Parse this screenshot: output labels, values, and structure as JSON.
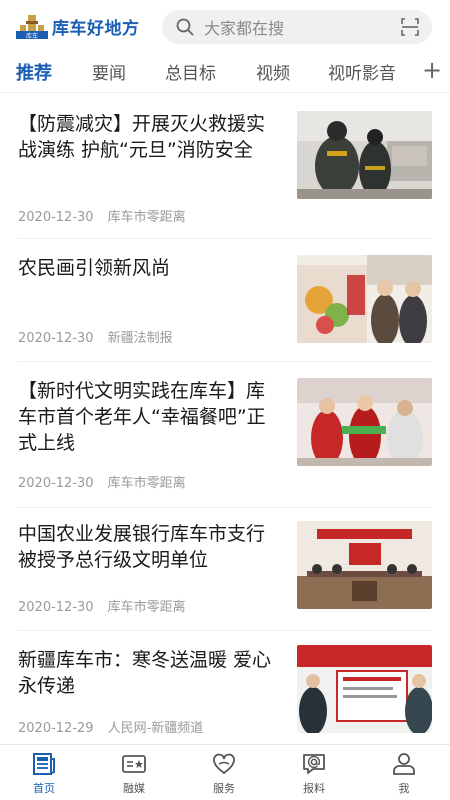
{
  "header": {
    "logo_text": "库车好地方",
    "logo_badge": "库车",
    "search_placeholder": "大家都在搜"
  },
  "tabs": [
    {
      "label": "推荐",
      "active": true
    },
    {
      "label": "要闻"
    },
    {
      "label": "总目标"
    },
    {
      "label": "视频"
    },
    {
      "label": "视听影音"
    }
  ],
  "articles": [
    {
      "title": "【防震减灾】开展灭火救援实战演练 护航“元旦”消防安全",
      "date": "2020-12-30",
      "source": "库车市零距离"
    },
    {
      "title": "农民画引领新风尚",
      "date": "2020-12-30",
      "source": "新疆法制报"
    },
    {
      "title": "【新时代文明实践在库车】库车市首个老年人“幸福餐吧”正式上线",
      "date": "2020-12-30",
      "source": "库车市零距离"
    },
    {
      "title": "中国农业发展银行库车市支行被授予总行级文明单位",
      "date": "2020-12-30",
      "source": "库车市零距离"
    },
    {
      "title": "新疆库车市：寒冬送温暖 爱心永传递",
      "date": "2020-12-29",
      "source": "人民网-新疆频道"
    }
  ],
  "bottom_nav": [
    {
      "label": "首页",
      "icon": "newspaper-icon",
      "active": true
    },
    {
      "label": "融媒",
      "icon": "media-card-icon"
    },
    {
      "label": "服务",
      "icon": "heart-hands-icon"
    },
    {
      "label": "报料",
      "icon": "chat-at-icon"
    },
    {
      "label": "我",
      "icon": "user-icon"
    }
  ],
  "colors": {
    "accent": "#1a5fb4",
    "meta": "#9a9a9a"
  }
}
